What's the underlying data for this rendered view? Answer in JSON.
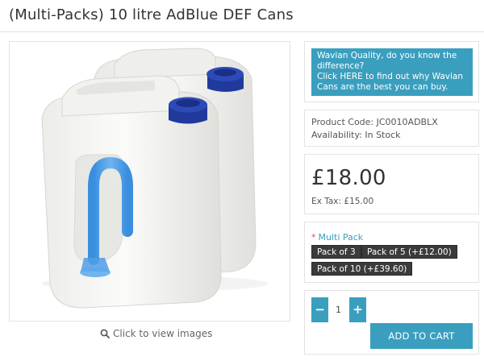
{
  "product": {
    "title": "(Multi-Packs) 10 litre AdBlue DEF Cans",
    "view_images": "Click to view images"
  },
  "quality_banner": {
    "line1": "Wavian Quality, do you know the",
    "line2": "difference?",
    "line3": "Click HERE to find out why Wavian",
    "line4": "Cans are the best you can buy."
  },
  "info": {
    "product_code": "Product Code: JC0010ADBLX",
    "availability": "Availability: In Stock"
  },
  "pricing": {
    "price": "£18.00",
    "ex_tax": "Ex Tax: £15.00"
  },
  "options": {
    "required_marker": "*",
    "label": "Multi Pack",
    "items": [
      "Pack of 3",
      "Pack of 5 (+£12.00)",
      "Pack of 10 (+£39.60)"
    ]
  },
  "purchase": {
    "minus": "−",
    "quantity": "1",
    "plus": "+",
    "add_to_cart": "ADD TO CART"
  },
  "colors": {
    "accent": "#3a9fbf",
    "option_bg": "#3b3b3b",
    "required": "#e05050"
  },
  "icons": {
    "zoom": "magnifier-icon"
  }
}
